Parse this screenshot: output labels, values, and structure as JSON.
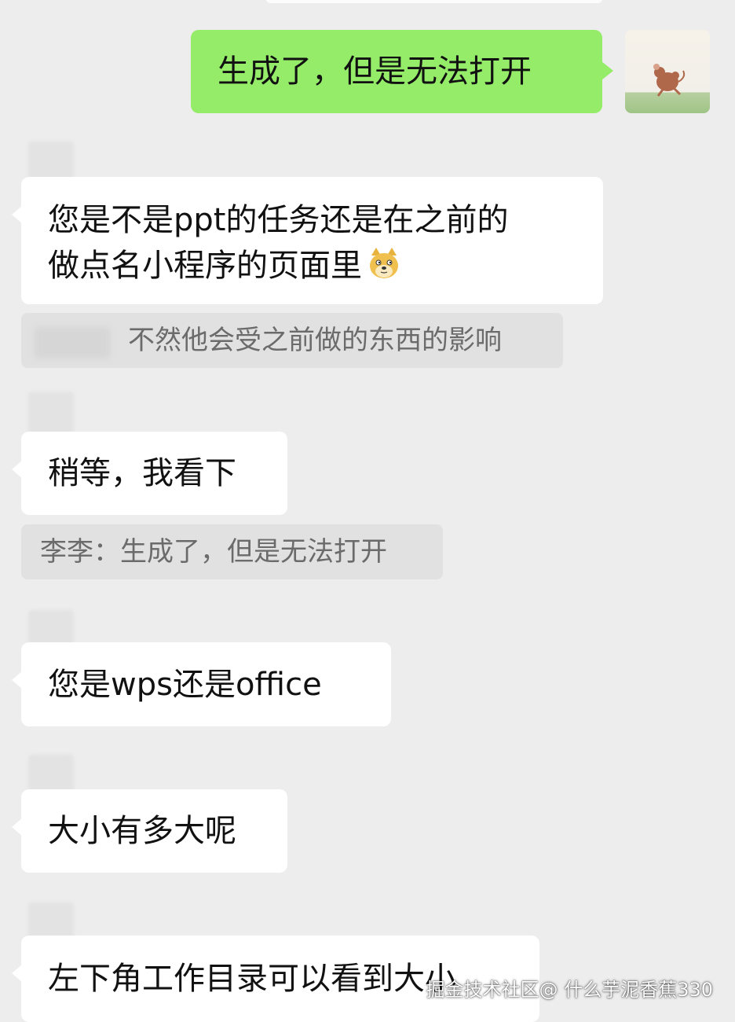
{
  "messages": {
    "m1": {
      "text": "生成了，但是无法打开"
    },
    "m2": {
      "line1": "您是不是ppt的任务还是在之前的",
      "line2": "做点名小程序的页面里"
    },
    "m3": {
      "text": "不然他会受之前做的东西的影响"
    },
    "m4": {
      "text": "稍等，我看下"
    },
    "m5": {
      "text": "李李：生成了，但是无法打开"
    },
    "m6": {
      "text": "您是wps还是office"
    },
    "m7": {
      "text": "大小有多大呢"
    },
    "m8": {
      "text": "左下角工作目录可以看到大小"
    }
  },
  "emoji": {
    "name": "doge-emoji"
  },
  "watermark": {
    "text": "掘金技术社区@ 什么芋泥香蕉330"
  },
  "colors": {
    "background": "#ededed",
    "self_bubble": "#95ec69",
    "other_bubble": "#ffffff",
    "quote_bg": "#e1e1e1",
    "quote_text": "#6b6b6b"
  }
}
